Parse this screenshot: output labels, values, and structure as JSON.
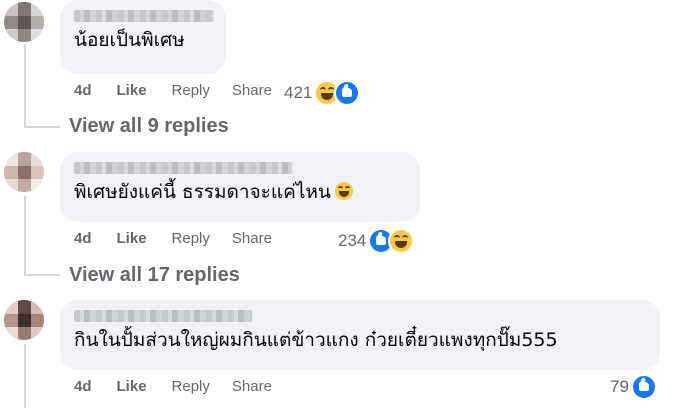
{
  "comments": [
    {
      "text": "น้อยเป็นพิเศษ",
      "age": "4d",
      "like": "Like",
      "reply": "Reply",
      "share": "Share",
      "reaction_count": "421",
      "reactions": [
        "haha-icon",
        "like-icon"
      ],
      "view_all": "View all 9 replies"
    },
    {
      "text": "พิเศษยังแค่นี้ ธรรมดาจะแค่ไหน",
      "age": "4d",
      "like": "Like",
      "reply": "Reply",
      "share": "Share",
      "reaction_count": "234",
      "reactions": [
        "like-icon",
        "haha-icon"
      ],
      "view_all": "View all 17 replies"
    },
    {
      "text": "กินในปั้มส่วนใหญ่ผมกินแต่ข้าวแกง ก๋วยเตี๋ยวแพงทุกปั๊ม555",
      "age": "4d",
      "like": "Like",
      "reply": "Reply",
      "share": "Share",
      "reaction_count": "79",
      "reactions": [
        "like-icon"
      ]
    }
  ],
  "colors": {
    "bubble": "#f0f2f5",
    "meta_text": "#65676b",
    "like_blue": "#1877f2",
    "haha_yellow": "#f7c84a"
  }
}
